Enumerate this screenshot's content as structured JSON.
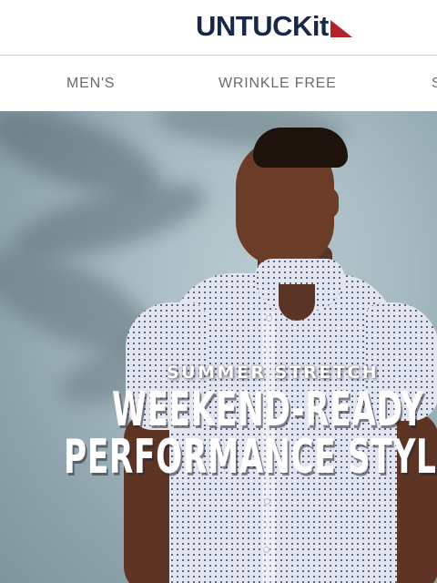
{
  "brand": {
    "name": "UNTUCKit",
    "accent": "#b5222f",
    "text_color": "#17284a"
  },
  "nav": {
    "items": [
      "MEN'S",
      "WRINKLE FREE",
      "S"
    ]
  },
  "hero": {
    "eyebrow": "SUMMER STRETCH",
    "headline_line1": "WEEKEND-READY",
    "headline_line2": "PERFORMANCE STYL"
  }
}
